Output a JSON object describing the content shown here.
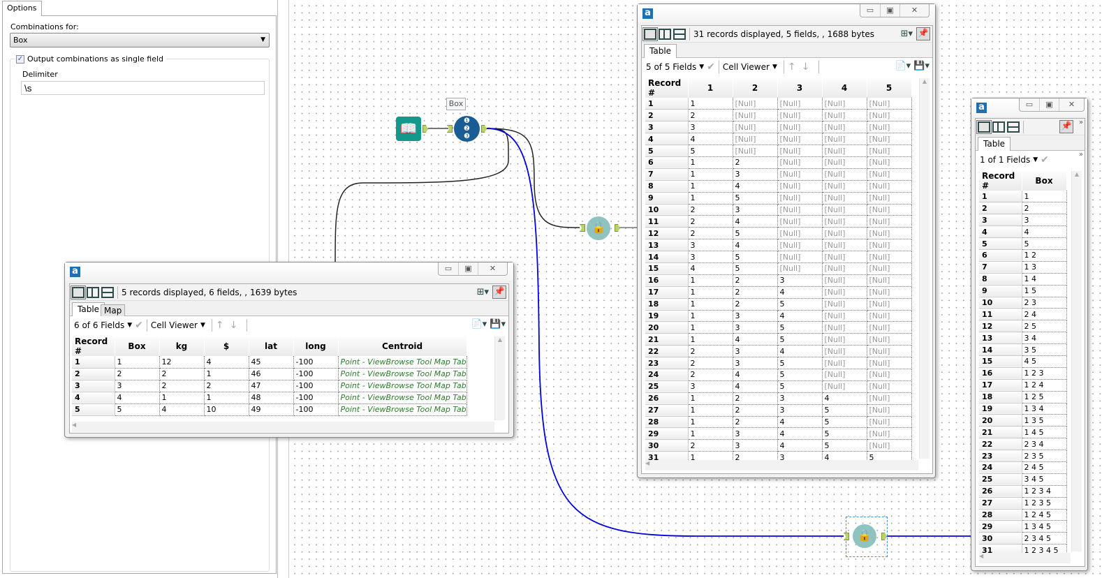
{
  "options_panel": {
    "tab_label": "Options",
    "combinations_label": "Combinations for:",
    "combinations_value": "Box",
    "single_field_checkbox_label": "Output combinations as single field",
    "single_field_checked": true,
    "delimiter_label": "Delimiter",
    "delimiter_value": "\\s"
  },
  "workflow": {
    "combo_tool_label": "Box",
    "wire_colors": {
      "default": "#1a1a1a",
      "selected": "#0000e0"
    },
    "tool_colors": {
      "input": "#13998a",
      "combinations": "#1a5c96",
      "browse": "#8fc3c0"
    }
  },
  "browse_input": {
    "app_logo": "a",
    "status": "5 records displayed, 6 fields, , 1639 bytes",
    "tabs": [
      "Table",
      "Map"
    ],
    "fields_selector": "6 of 6 Fields",
    "cell_viewer": "Cell Viewer",
    "columns": [
      "Record #",
      "Box",
      "kg",
      "$",
      "lat",
      "long",
      "Centroid"
    ],
    "rows": [
      [
        "1",
        "1",
        "12",
        "4",
        "45",
        "-100",
        "Point - ViewBrowse Tool Map Tab"
      ],
      [
        "2",
        "2",
        "2",
        "1",
        "46",
        "-100",
        "Point - ViewBrowse Tool Map Tab"
      ],
      [
        "3",
        "3",
        "2",
        "2",
        "47",
        "-100",
        "Point - ViewBrowse Tool Map Tab"
      ],
      [
        "4",
        "4",
        "1",
        "1",
        "48",
        "-100",
        "Point - ViewBrowse Tool Map Tab"
      ],
      [
        "5",
        "5",
        "4",
        "10",
        "49",
        "-100",
        "Point - ViewBrowse Tool Map Tab"
      ]
    ]
  },
  "browse_fields": {
    "app_logo": "a",
    "status": "31 records displayed, 5 fields, , 1688 bytes",
    "tabs": [
      "Table"
    ],
    "fields_selector": "5 of 5 Fields",
    "cell_viewer": "Cell Viewer",
    "columns": [
      "Record #",
      "1",
      "2",
      "3",
      "4",
      "5"
    ],
    "rows": [
      [
        "1",
        "1",
        "[Null]",
        "[Null]",
        "[Null]",
        "[Null]"
      ],
      [
        "2",
        "2",
        "[Null]",
        "[Null]",
        "[Null]",
        "[Null]"
      ],
      [
        "3",
        "3",
        "[Null]",
        "[Null]",
        "[Null]",
        "[Null]"
      ],
      [
        "4",
        "4",
        "[Null]",
        "[Null]",
        "[Null]",
        "[Null]"
      ],
      [
        "5",
        "5",
        "[Null]",
        "[Null]",
        "[Null]",
        "[Null]"
      ],
      [
        "6",
        "1",
        "2",
        "[Null]",
        "[Null]",
        "[Null]"
      ],
      [
        "7",
        "1",
        "3",
        "[Null]",
        "[Null]",
        "[Null]"
      ],
      [
        "8",
        "1",
        "4",
        "[Null]",
        "[Null]",
        "[Null]"
      ],
      [
        "9",
        "1",
        "5",
        "[Null]",
        "[Null]",
        "[Null]"
      ],
      [
        "10",
        "2",
        "3",
        "[Null]",
        "[Null]",
        "[Null]"
      ],
      [
        "11",
        "2",
        "4",
        "[Null]",
        "[Null]",
        "[Null]"
      ],
      [
        "12",
        "2",
        "5",
        "[Null]",
        "[Null]",
        "[Null]"
      ],
      [
        "13",
        "3",
        "4",
        "[Null]",
        "[Null]",
        "[Null]"
      ],
      [
        "14",
        "3",
        "5",
        "[Null]",
        "[Null]",
        "[Null]"
      ],
      [
        "15",
        "4",
        "5",
        "[Null]",
        "[Null]",
        "[Null]"
      ],
      [
        "16",
        "1",
        "2",
        "3",
        "[Null]",
        "[Null]"
      ],
      [
        "17",
        "1",
        "2",
        "4",
        "[Null]",
        "[Null]"
      ],
      [
        "18",
        "1",
        "2",
        "5",
        "[Null]",
        "[Null]"
      ],
      [
        "19",
        "1",
        "3",
        "4",
        "[Null]",
        "[Null]"
      ],
      [
        "20",
        "1",
        "3",
        "5",
        "[Null]",
        "[Null]"
      ],
      [
        "21",
        "1",
        "4",
        "5",
        "[Null]",
        "[Null]"
      ],
      [
        "22",
        "2",
        "3",
        "4",
        "[Null]",
        "[Null]"
      ],
      [
        "23",
        "2",
        "3",
        "5",
        "[Null]",
        "[Null]"
      ],
      [
        "24",
        "2",
        "4",
        "5",
        "[Null]",
        "[Null]"
      ],
      [
        "25",
        "3",
        "4",
        "5",
        "[Null]",
        "[Null]"
      ],
      [
        "26",
        "1",
        "2",
        "3",
        "4",
        "[Null]"
      ],
      [
        "27",
        "1",
        "2",
        "3",
        "5",
        "[Null]"
      ],
      [
        "28",
        "1",
        "2",
        "4",
        "5",
        "[Null]"
      ],
      [
        "29",
        "1",
        "3",
        "4",
        "5",
        "[Null]"
      ],
      [
        "30",
        "2",
        "3",
        "4",
        "5",
        "[Null]"
      ],
      [
        "31",
        "1",
        "2",
        "3",
        "4",
        "5"
      ]
    ]
  },
  "browse_single": {
    "app_logo": "a",
    "tabs": [
      "Table"
    ],
    "fields_selector": "1 of 1 Fields",
    "columns": [
      "Record #",
      "Box"
    ],
    "rows": [
      [
        "1",
        "1"
      ],
      [
        "2",
        "2"
      ],
      [
        "3",
        "3"
      ],
      [
        "4",
        "4"
      ],
      [
        "5",
        "5"
      ],
      [
        "6",
        "1 2"
      ],
      [
        "7",
        "1 3"
      ],
      [
        "8",
        "1 4"
      ],
      [
        "9",
        "1 5"
      ],
      [
        "10",
        "2 3"
      ],
      [
        "11",
        "2 4"
      ],
      [
        "12",
        "2 5"
      ],
      [
        "13",
        "3 4"
      ],
      [
        "14",
        "3 5"
      ],
      [
        "15",
        "4 5"
      ],
      [
        "16",
        "1 2 3"
      ],
      [
        "17",
        "1 2 4"
      ],
      [
        "18",
        "1 2 5"
      ],
      [
        "19",
        "1 3 4"
      ],
      [
        "20",
        "1 3 5"
      ],
      [
        "21",
        "1 4 5"
      ],
      [
        "22",
        "2 3 4"
      ],
      [
        "23",
        "2 3 5"
      ],
      [
        "24",
        "2 4 5"
      ],
      [
        "25",
        "3 4 5"
      ],
      [
        "26",
        "1 2 3 4"
      ],
      [
        "27",
        "1 2 3 5"
      ],
      [
        "28",
        "1 2 4 5"
      ],
      [
        "29",
        "1 3 4 5"
      ],
      [
        "30",
        "2 3 4 5"
      ],
      [
        "31",
        "1 2 3 4 5"
      ]
    ]
  }
}
